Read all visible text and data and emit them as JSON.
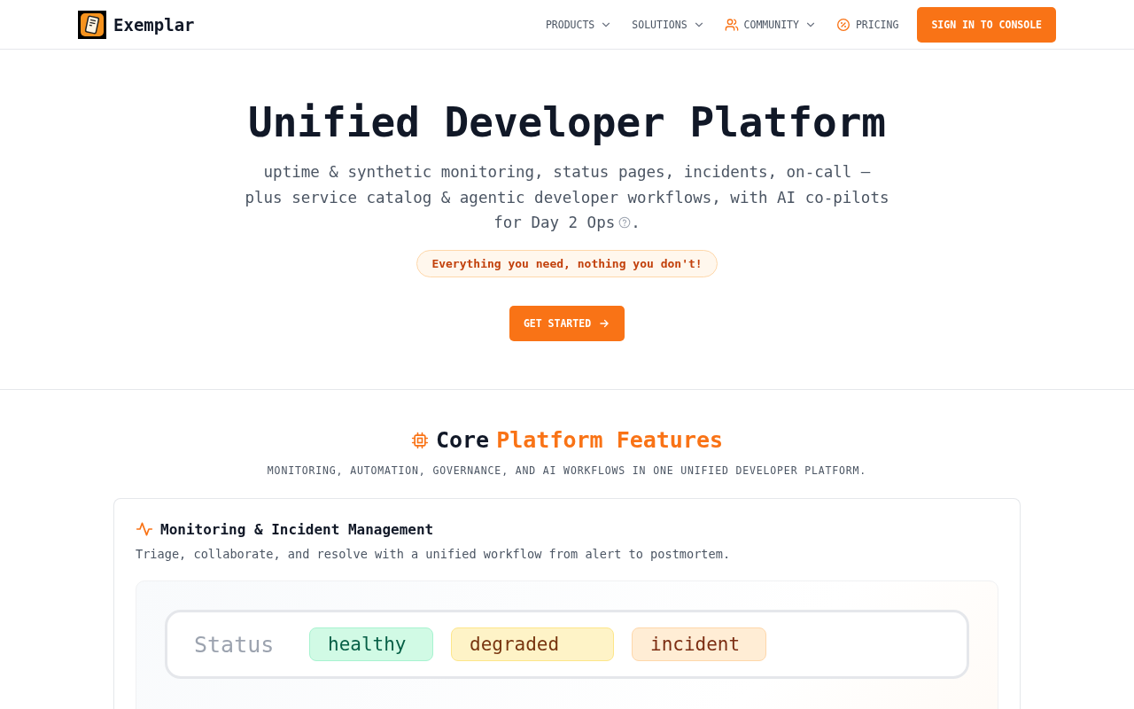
{
  "header": {
    "brand": "Exemplar",
    "nav": [
      {
        "label": "PRODUCTS",
        "kind": "dropdown"
      },
      {
        "label": "SOLUTIONS",
        "kind": "dropdown"
      },
      {
        "label": "COMMUNITY",
        "kind": "people-dropdown"
      },
      {
        "label": "PRICING",
        "kind": "badge-link"
      }
    ],
    "cta": "SIGN IN TO CONSOLE"
  },
  "hero": {
    "title": "Unified Developer Platform",
    "subtitle_lines": [
      "uptime & synthetic monitoring, status pages, incidents, on-call —",
      "plus service catalog & agentic developer workflows, with AI co-pilots",
      "for Day 2 Ops"
    ],
    "subtitle_end": ".",
    "tagline": "Everything you need, nothing you don't!",
    "button": "GET STARTED"
  },
  "features": {
    "title_plain": "Core",
    "title_accent": "Platform Features",
    "subtitle": "MONITORING, AUTOMATION, GOVERNANCE, AND AI WORKFLOWS IN ONE UNIFIED DEVELOPER PLATFORM.",
    "card": {
      "title": "Monitoring & Incident Management",
      "description": "Triage, collaborate, and resolve with a unified workflow from alert to postmortem.",
      "status_label": "Status",
      "statuses": [
        {
          "label": "healthy",
          "kind": "healthy"
        },
        {
          "label": "degraded",
          "kind": "degraded"
        },
        {
          "label": "incident",
          "kind": "incident"
        }
      ]
    }
  }
}
